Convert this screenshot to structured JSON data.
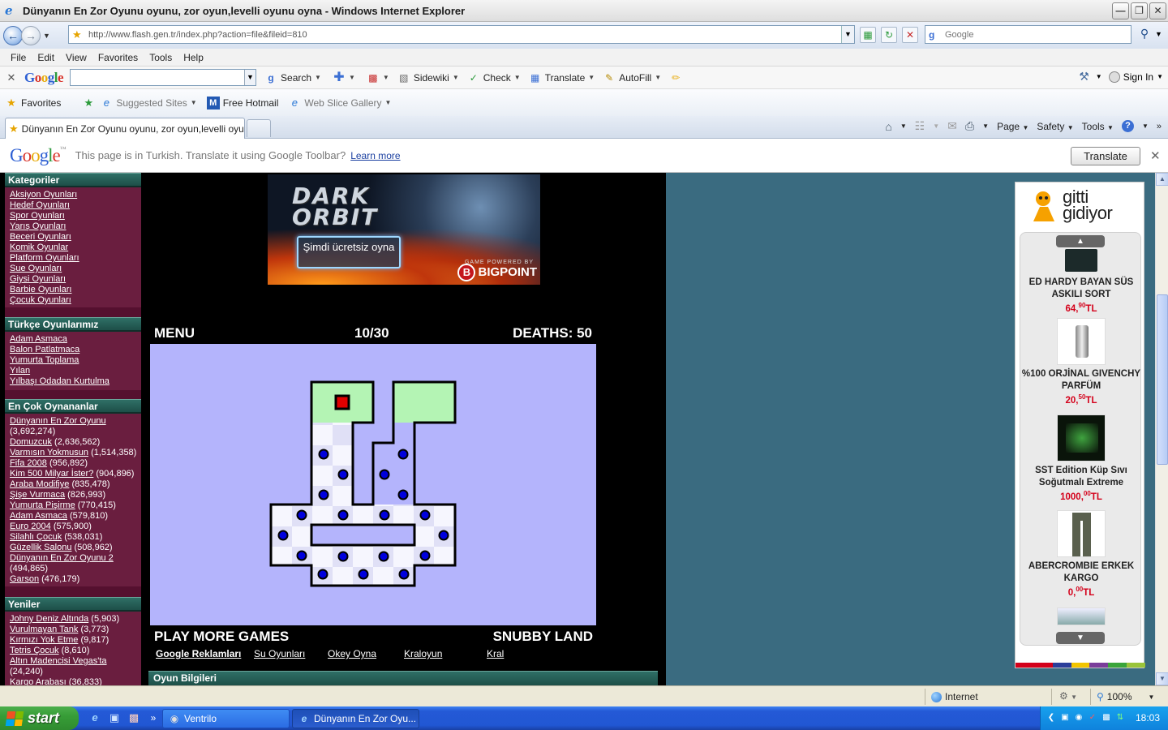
{
  "window": {
    "title": "Dünyanın En Zor Oyunu oyunu, zor oyun,levelli oyunu oyna - Windows Internet Explorer"
  },
  "address": {
    "url": "http://www.flash.gen.tr/index.php?action=file&fileid=810",
    "search_placeholder": "Google"
  },
  "menu": [
    "File",
    "Edit",
    "View",
    "Favorites",
    "Tools",
    "Help"
  ],
  "google_toolbar": {
    "search_label": "Search",
    "sidewiki_label": "Sidewiki",
    "check_label": "Check",
    "translate_label": "Translate",
    "autofill_label": "AutoFill",
    "signin_label": "Sign In"
  },
  "favorites_bar": {
    "favorites_label": "Favorites",
    "suggested_label": "Suggested Sites",
    "hotmail_label": "Free Hotmail",
    "webslice_label": "Web Slice Gallery"
  },
  "tab": {
    "title": "Dünyanın En Zor Oyunu oyunu, zor oyun,levelli oyunu ..."
  },
  "command_bar": {
    "page_label": "Page",
    "safety_label": "Safety",
    "tools_label": "Tools"
  },
  "translate_bar": {
    "message": "This page is in Turkish.  Translate it using Google Toolbar?",
    "learn_more": "Learn more",
    "button": "Translate"
  },
  "sidebar": {
    "kategoriler": {
      "title": "Kategoriler",
      "items": [
        "Aksiyon Oyunları",
        "Hedef Oyunları",
        "Spor Oyunları",
        "Yarış Oyunları",
        "Beceri Oyunları",
        "Komik Oyunlar",
        "Platform Oyunları",
        "Sue Oyunları",
        "Giysi Oyunları",
        "Barbie Oyunları",
        "Çocuk Oyunları"
      ]
    },
    "turkce": {
      "title": "Türkçe Oyunlarımız",
      "items": [
        "Adam Asmaca",
        "Balon Patlatmaca",
        "Yumurta Toplama",
        "Yılan",
        "Yılbaşı Odadan Kurtulma"
      ]
    },
    "encok": {
      "title": "En Çok Oynananlar",
      "items": [
        {
          "name": "Dünyanın En Zor Oyunu",
          "count": "(3,692,274)"
        },
        {
          "name": "Domuzcuk",
          "count": "(2,636,562)"
        },
        {
          "name": "Varmısın Yokmusun",
          "count": "(1,514,358)"
        },
        {
          "name": "Fifa 2008",
          "count": "(956,892)"
        },
        {
          "name": "Kim 500 Milyar İster?",
          "count": "(904,896)"
        },
        {
          "name": "Araba Modifiye",
          "count": "(835,478)"
        },
        {
          "name": "Şişe Vurmaca",
          "count": "(826,993)"
        },
        {
          "name": "Yumurta Pişirme",
          "count": "(770,415)"
        },
        {
          "name": "Adam Asmaca",
          "count": "(579,810)"
        },
        {
          "name": "Euro 2004",
          "count": "(575,900)"
        },
        {
          "name": "Silahlı Çocuk",
          "count": "(538,031)"
        },
        {
          "name": "Güzellik Salonu",
          "count": "(508,962)"
        },
        {
          "name": "Dünyanın En Zor Oyunu 2",
          "count": "(494,865)"
        },
        {
          "name": "Garson",
          "count": "(476,179)"
        }
      ]
    },
    "yeniler": {
      "title": "Yeniler",
      "items": [
        {
          "name": "Johny Deniz Altında",
          "count": "(5,903)"
        },
        {
          "name": "Vurulmayan Tank",
          "count": "(3,773)"
        },
        {
          "name": "Kırmızı Yok Etme",
          "count": "(9,817)"
        },
        {
          "name": "Tetris Çocuk",
          "count": "(8,610)"
        },
        {
          "name": "Altın Madencisi Vegas'ta",
          "count": "(24,240)"
        },
        {
          "name": "Kargo Arabası",
          "count": "(36,833)"
        }
      ]
    }
  },
  "banner": {
    "logo_line1": "DARK",
    "logo_line2": "ORBIT",
    "cta": "Şimdi ücretsiz oyna",
    "powered": "GAME POWERED BY",
    "brand": "BIGPOINT"
  },
  "game": {
    "menu_label": "MENU",
    "level": "10/30",
    "deaths": "DEATHS: 50",
    "play_more": "PLAY MORE GAMES",
    "brand": "SNUBBY LAND"
  },
  "links": [
    "Google Reklamları",
    "Su Oyunları",
    "Okey Oyna",
    "Kraloyun",
    "Kral"
  ],
  "info_bar": "Oyun Bilgileri",
  "ad": {
    "brand": "gitti gidiyor",
    "items": [
      {
        "name": "ED HARDY BAYAN SÜS ASKILI SORT",
        "price_main": "64,",
        "price_cents": "90",
        "currency": "TL"
      },
      {
        "name": "%100 ORJİNAL GIVENCHY PARFÜM",
        "price_main": "20,",
        "price_cents": "50",
        "currency": "TL"
      },
      {
        "name": "SST Edition Küp Sıvı Soğutmalı Extreme",
        "price_main": "1000,",
        "price_cents": "00",
        "currency": "TL"
      },
      {
        "name": "ABERCROMBIE ERKEK KARGO",
        "price_main": "0,",
        "price_cents": "00",
        "currency": "TL"
      }
    ]
  },
  "status": {
    "zone": "Internet",
    "zoom": "100%"
  },
  "taskbar": {
    "start": "start",
    "tasks": [
      "Ventrilo",
      "Dünyanın En Zor Oyu..."
    ],
    "clock": "18:03"
  }
}
